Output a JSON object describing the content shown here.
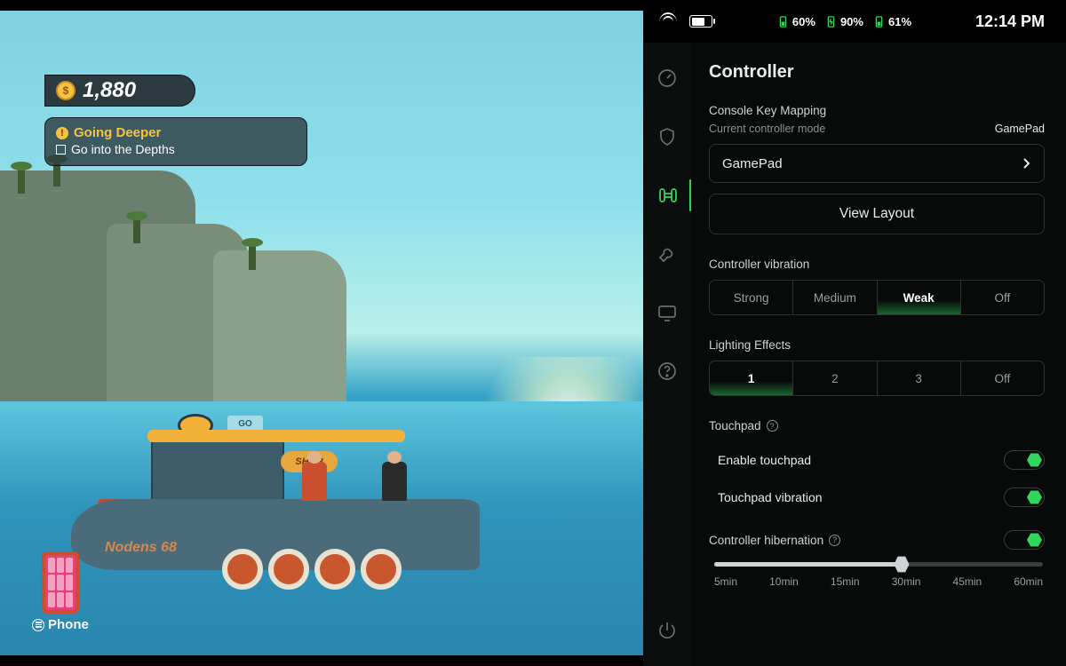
{
  "statusbar": {
    "time": "12:14 PM",
    "batteries": [
      {
        "pct": "60%",
        "color": "#33d65c",
        "charging": false
      },
      {
        "pct": "90%",
        "color": "#33d65c",
        "charging": true
      },
      {
        "pct": "61%",
        "color": "#33d65c",
        "charging": false
      }
    ]
  },
  "sidebar": {
    "items": [
      {
        "name": "performance",
        "active": false
      },
      {
        "name": "security",
        "active": false
      },
      {
        "name": "controller",
        "active": true
      },
      {
        "name": "tools",
        "active": false
      },
      {
        "name": "display",
        "active": false
      },
      {
        "name": "help",
        "active": false
      }
    ]
  },
  "panel": {
    "title": "Controller",
    "keymap_label": "Console Key Mapping",
    "mode_label": "Current controller mode",
    "mode_value": "GamePad",
    "mode_selector": "GamePad",
    "view_layout": "View Layout",
    "vibration": {
      "label": "Controller vibration",
      "options": [
        "Strong",
        "Medium",
        "Weak",
        "Off"
      ],
      "selected": "Weak"
    },
    "lighting": {
      "label": "Lighting Effects",
      "options": [
        "1",
        "2",
        "3",
        "Off"
      ],
      "selected": "1"
    },
    "touchpad": {
      "label": "Touchpad",
      "enable_label": "Enable touchpad",
      "enable_on": true,
      "vibration_label": "Touchpad vibration",
      "vibration_on": true
    },
    "hibernation": {
      "label": "Controller hibernation",
      "on": true,
      "ticks": [
        "5min",
        "10min",
        "15min",
        "30min",
        "45min",
        "60min"
      ],
      "value_index": 3
    }
  },
  "game": {
    "currency": "1,880",
    "quest_title": "Going Deeper",
    "quest_item": "Go into the Depths",
    "boat_name": "Nodens 68",
    "shop_label": "SHOP",
    "go_label": "GO",
    "phone_label": "Phone"
  }
}
